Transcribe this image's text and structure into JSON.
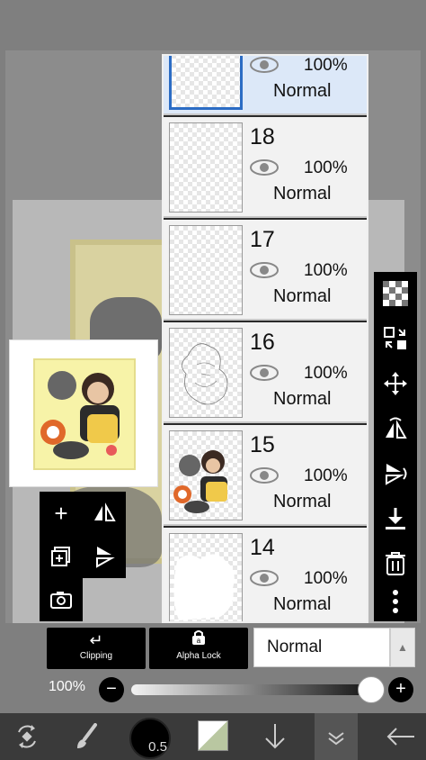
{
  "layers": [
    {
      "number": "",
      "opacity": "100%",
      "blend": "Normal",
      "selected": true
    },
    {
      "number": "18",
      "opacity": "100%",
      "blend": "Normal",
      "selected": false
    },
    {
      "number": "17",
      "opacity": "100%",
      "blend": "Normal",
      "selected": false
    },
    {
      "number": "16",
      "opacity": "100%",
      "blend": "Normal",
      "selected": false
    },
    {
      "number": "15",
      "opacity": "100%",
      "blend": "Normal",
      "selected": false
    },
    {
      "number": "14",
      "opacity": "100%",
      "blend": "Normal",
      "selected": false
    }
  ],
  "controls": {
    "clipping_label": "Clipping",
    "alpha_lock_label": "Alpha Lock",
    "blend_mode": "Normal",
    "opacity_value": "100%",
    "opacity_fraction": 1.0
  },
  "brush": {
    "size": "0.5"
  },
  "icons": {
    "left_tools": [
      "add-layer-icon",
      "flip-horizontal-icon",
      "duplicate-layer-icon",
      "flip-vertical-icon",
      "camera-icon"
    ],
    "right_tools": [
      "checker-icon",
      "transform-icon",
      "move-icon",
      "flip-horizontal-icon",
      "flip-vertical-icon",
      "merge-down-icon",
      "trash-icon",
      "more-icon"
    ],
    "bottom_bar": [
      "transform-tool-icon",
      "brush-icon",
      "brush-size-icon",
      "color-icon",
      "down-arrow-icon",
      "layers-icon",
      "back-icon"
    ]
  },
  "colors": {
    "selected_layer": "#dce8f8",
    "selection_border": "#2b6cc4",
    "toolbar": "#000000"
  }
}
